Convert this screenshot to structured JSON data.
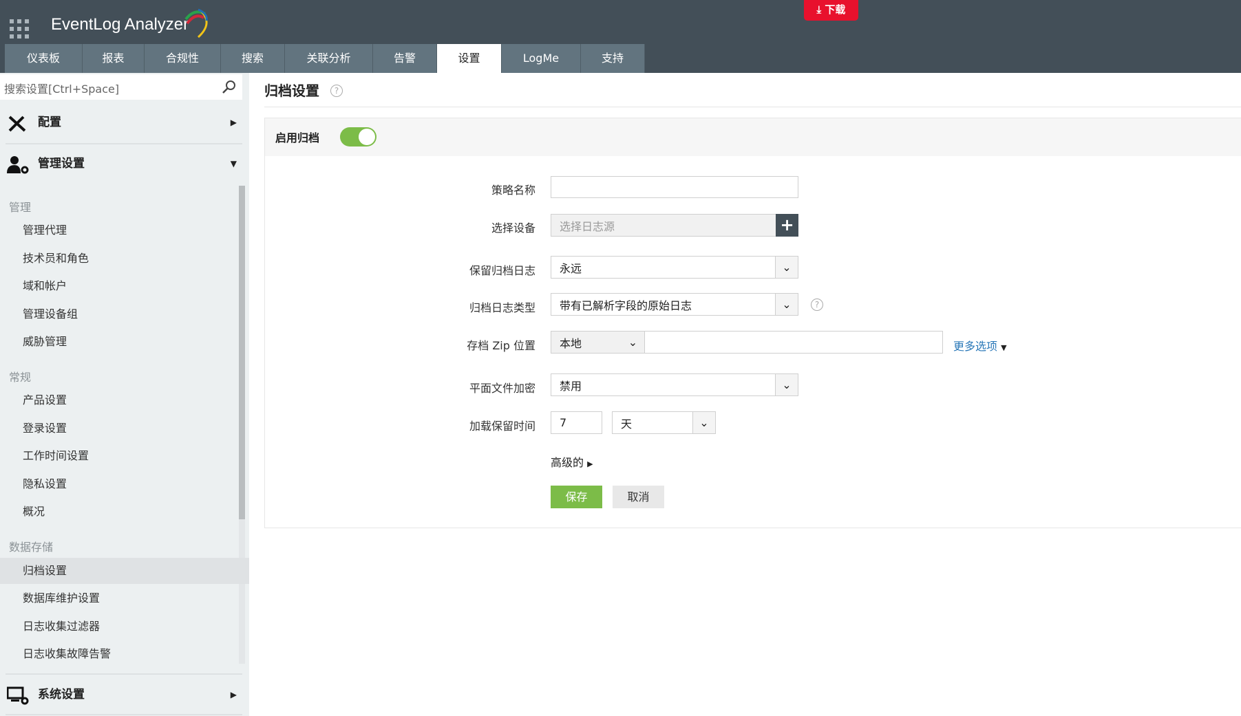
{
  "header": {
    "app_name": "EventLog Analyzer",
    "download_label": "下载"
  },
  "tabs": [
    "仪表板",
    "报表",
    "合规性",
    "搜索",
    "关联分析",
    "告警",
    "设置",
    "LogMe",
    "支持"
  ],
  "active_tab": "设置",
  "sidebar": {
    "search_placeholder": "搜索设置[Ctrl+Space]",
    "groups": {
      "config": "配置",
      "admin": "管理设置",
      "system": "系统设置"
    },
    "sections": [
      {
        "title": "管理",
        "items": [
          "管理代理",
          "技术员和角色",
          "域和帐户",
          "管理设备组",
          "威胁管理"
        ]
      },
      {
        "title": "常规",
        "items": [
          "产品设置",
          "登录设置",
          "工作时间设置",
          "隐私设置",
          "概况"
        ]
      },
      {
        "title": "数据存储",
        "items": [
          "归档设置",
          "数据库维护设置",
          "日志收集过滤器",
          "日志收集故障告警"
        ]
      }
    ],
    "selected": "归档设置"
  },
  "main": {
    "title": "归档设置",
    "enable_label": "启用归档",
    "enabled": true,
    "form": {
      "policy_name_label": "策略名称",
      "policy_name_value": "",
      "device_label": "选择设备",
      "device_placeholder": "选择日志源",
      "retain_label": "保留归档日志",
      "retain_value": "永远",
      "type_label": "归档日志类型",
      "type_value": "带有已解析字段的原始日志",
      "zip_label": "存档 Zip 位置",
      "zip_value": "本地",
      "zip_path": "",
      "more_options": "更多选项",
      "encrypt_label": "平面文件加密",
      "encrypt_value": "禁用",
      "load_label": "加载保留时间",
      "load_value": "7",
      "load_unit": "天",
      "advanced": "高级的",
      "save": "保存",
      "cancel": "取消"
    }
  },
  "colors": {
    "header": "#434f58",
    "tab": "#62747f",
    "accent_green": "#7cbc48",
    "download_red": "#e8112d",
    "link": "#2a78b8"
  }
}
